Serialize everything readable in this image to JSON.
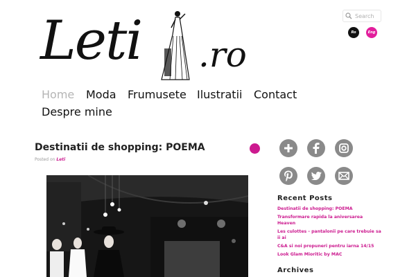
{
  "logo": {
    "main": "Leti",
    "suffix": ".ro"
  },
  "search": {
    "placeholder": "Search"
  },
  "languages": {
    "ro": "Ro",
    "eng": "Eng"
  },
  "nav": {
    "items": [
      {
        "label": "Home"
      },
      {
        "label": "Moda"
      },
      {
        "label": "Frumusete"
      },
      {
        "label": "Ilustratii"
      },
      {
        "label": "Contact"
      },
      {
        "label": "Despre mine"
      }
    ]
  },
  "post": {
    "title": "Destinatii de shopping: POEMA",
    "posted_prefix": "Posted on",
    "author": "Leti"
  },
  "social": [
    "plus-icon",
    "facebook-icon",
    "instagram-icon",
    "pinterest-icon",
    "twitter-icon",
    "email-icon"
  ],
  "sidebar": {
    "recent_title": "Recent Posts",
    "recent_posts": [
      "Destinatii de shopping: POEMA",
      "Transformare rapida la aniversarea Heaven",
      "Les culottes - pantalonii pe care trebuie sa ii ai",
      "C&A si noi propuneri pentru iarna 14/15",
      "Look Glam Mioritic by MAC"
    ],
    "archives_title": "Archives"
  },
  "colors": {
    "accent": "#cc1a8f",
    "nav_active": "#b5b5b5",
    "icon_gray": "#8a8a8a"
  }
}
